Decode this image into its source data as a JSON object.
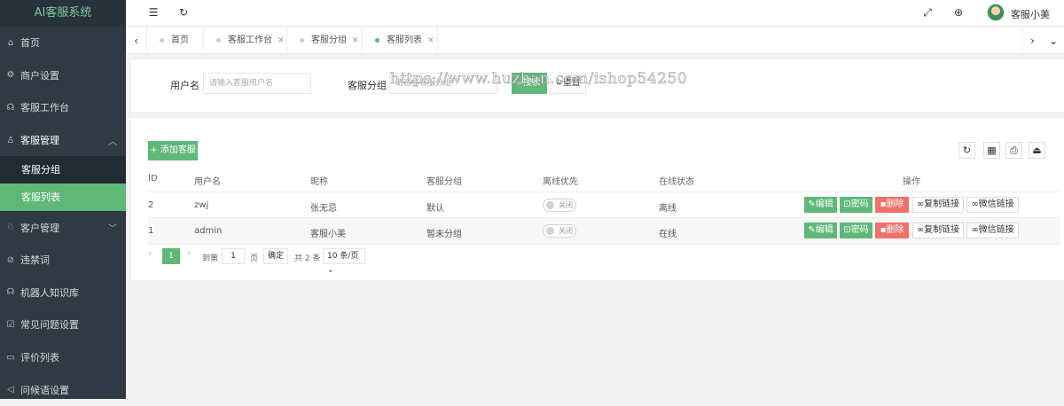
{
  "app": {
    "title": "AI客服系统"
  },
  "sidebar": {
    "items": [
      {
        "label": "首页",
        "icon": "home-icon"
      },
      {
        "label": "商户设置",
        "icon": "gear-icon"
      },
      {
        "label": "客服工作台",
        "icon": "headset-icon"
      },
      {
        "label": "客服管理",
        "icon": "user-icon",
        "expanded": true,
        "children": [
          {
            "label": "客服分组"
          },
          {
            "label": "客服列表",
            "active": true
          }
        ]
      },
      {
        "label": "客户管理",
        "icon": "customer-icon"
      },
      {
        "label": "违禁词",
        "icon": "ban-icon"
      },
      {
        "label": "机器人知识库",
        "icon": "robot-icon"
      },
      {
        "label": "常见问题设置",
        "icon": "faq-icon"
      },
      {
        "label": "评价列表",
        "icon": "comment-icon"
      },
      {
        "label": "问候语设置",
        "icon": "send-icon"
      }
    ]
  },
  "header": {
    "user_name": "客服小美"
  },
  "tabs": [
    {
      "label": "首页",
      "closable": false
    },
    {
      "label": "客服工作台",
      "closable": true
    },
    {
      "label": "客服分组",
      "closable": true
    },
    {
      "label": "客服列表",
      "closable": true,
      "active": true
    }
  ],
  "search": {
    "username_label": "用户名",
    "username_placeholder": "请输入客服用户名",
    "group_label": "客服分组",
    "group_placeholder": "请选择客服分组",
    "search_button": "搜索",
    "reset_button": "重置"
  },
  "watermark": "https://www.huzhan.com/ishop54250",
  "table": {
    "add_button": "添加客服",
    "columns": [
      "ID",
      "用户名",
      "昵称",
      "客服分组",
      "离线优先",
      "在线状态",
      "操作"
    ],
    "rows": [
      {
        "id": "2",
        "username": "zwj",
        "nickname": "张无忌",
        "group": "默认",
        "offline_first": "关闭",
        "status": "离线"
      },
      {
        "id": "1",
        "username": "admin",
        "nickname": "客服小美",
        "group": "暂未分组",
        "offline_first": "关闭",
        "status": "在线"
      }
    ],
    "actions": {
      "edit": "编辑",
      "password": "密码",
      "delete": "删除",
      "copy_link": "复制链接",
      "wechat_link": "微信链接"
    }
  },
  "pager": {
    "current_page": "1",
    "goto_label": "到第",
    "goto_value": "1",
    "page_unit": "页",
    "confirm": "确定",
    "total": "共 2 条",
    "page_size": "10 条/页"
  },
  "colors": {
    "accent": "#5fb878",
    "danger": "#f0706a",
    "sidebar": "#2f3a44"
  }
}
